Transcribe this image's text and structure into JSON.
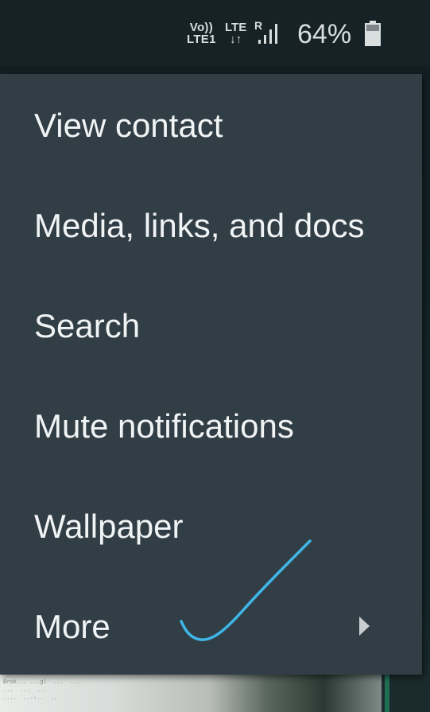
{
  "status_bar": {
    "volte_top": "Vo))",
    "volte_bottom": "LTE1",
    "network_top": "LTE",
    "network_bottom": "↓↑",
    "roaming": "R",
    "battery_percent": "64%",
    "icons": [
      "signal-icon",
      "battery-icon"
    ]
  },
  "background": {
    "image_text_line1": "Brok... ...gl  ...  ...",
    "image_text_line2": "...  ...  ...",
    "image_text_line3": "....  ..-:..  .."
  },
  "menu": {
    "items": [
      {
        "label": "View contact"
      },
      {
        "label": "Media, links, and docs"
      },
      {
        "label": "Search"
      },
      {
        "label": "Mute notifications"
      },
      {
        "label": "Wallpaper"
      },
      {
        "label": "More",
        "has_submenu": true
      }
    ]
  },
  "annotation": {
    "mark": "checkmark",
    "color": "#3fb6e8"
  },
  "colors": {
    "menu_background": "#323e45",
    "menu_text": "#f1f4f5",
    "status_bar": "#172226"
  }
}
